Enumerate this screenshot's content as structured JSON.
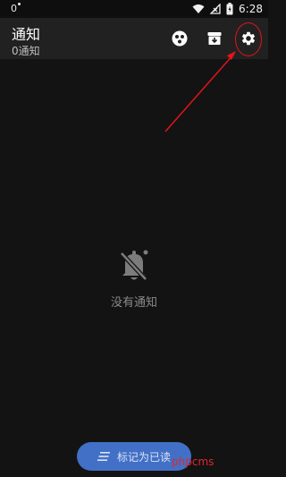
{
  "status_bar": {
    "left_text": "0",
    "time": "6:28",
    "icons": [
      "wifi-icon",
      "signal-icon",
      "battery-icon"
    ]
  },
  "header": {
    "title": "通知",
    "subtitle": "0通知",
    "actions": [
      "apps-icon",
      "archive-icon",
      "gear-icon"
    ]
  },
  "empty_state": {
    "icon": "bell-off-icon",
    "message": "没有通知"
  },
  "fab": {
    "icon": "list-icon",
    "label": "标记为已读"
  },
  "watermark": "phpcms",
  "colors": {
    "background": "#131313",
    "app_bar": "#212121",
    "fab": "#4270c6",
    "annotation": "#e3141a"
  }
}
